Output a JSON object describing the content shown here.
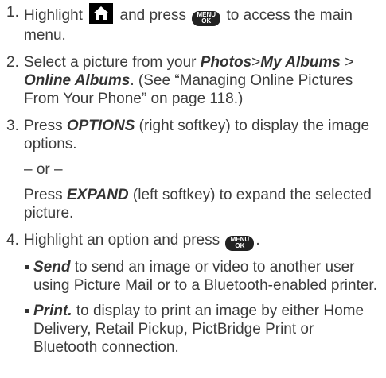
{
  "steps": {
    "s1": {
      "num": "1.",
      "a": "Highlight",
      "b": "and press",
      "c": "to access the main menu."
    },
    "s2": {
      "num": "2.",
      "a": "Select a picture from your",
      "photos": "Photos",
      "albums": "My Albums",
      "online": "Online Albums",
      "c": ". (See “Managing Online Pictures From Your Phone” on page 118.)"
    },
    "s3": {
      "num": "3.",
      "a": "Press",
      "options": "OPTIONS",
      "b": "(right softkey) to display the image options.",
      "or": "– or –",
      "c": "Press",
      "expand": "EXPAND",
      "d": "(left softkey) to expand the selected picture."
    },
    "s4": {
      "num": "4.",
      "a": "Highlight an option and press",
      "b": "."
    }
  },
  "bullets": [
    {
      "term": "Send",
      "text": "to send an image or video to another user using Picture Mail or to a Bluetooth-enabled printer."
    },
    {
      "term": "Print.",
      "text": "to display to print an image by either Home Delivery, Retail Pickup, PictBridge Print or Bluetooth connection."
    }
  ],
  "keys": {
    "menu_top": "MENU",
    "menu_bottom": "OK",
    "home_icon": "home-icon"
  },
  "separator": ">"
}
